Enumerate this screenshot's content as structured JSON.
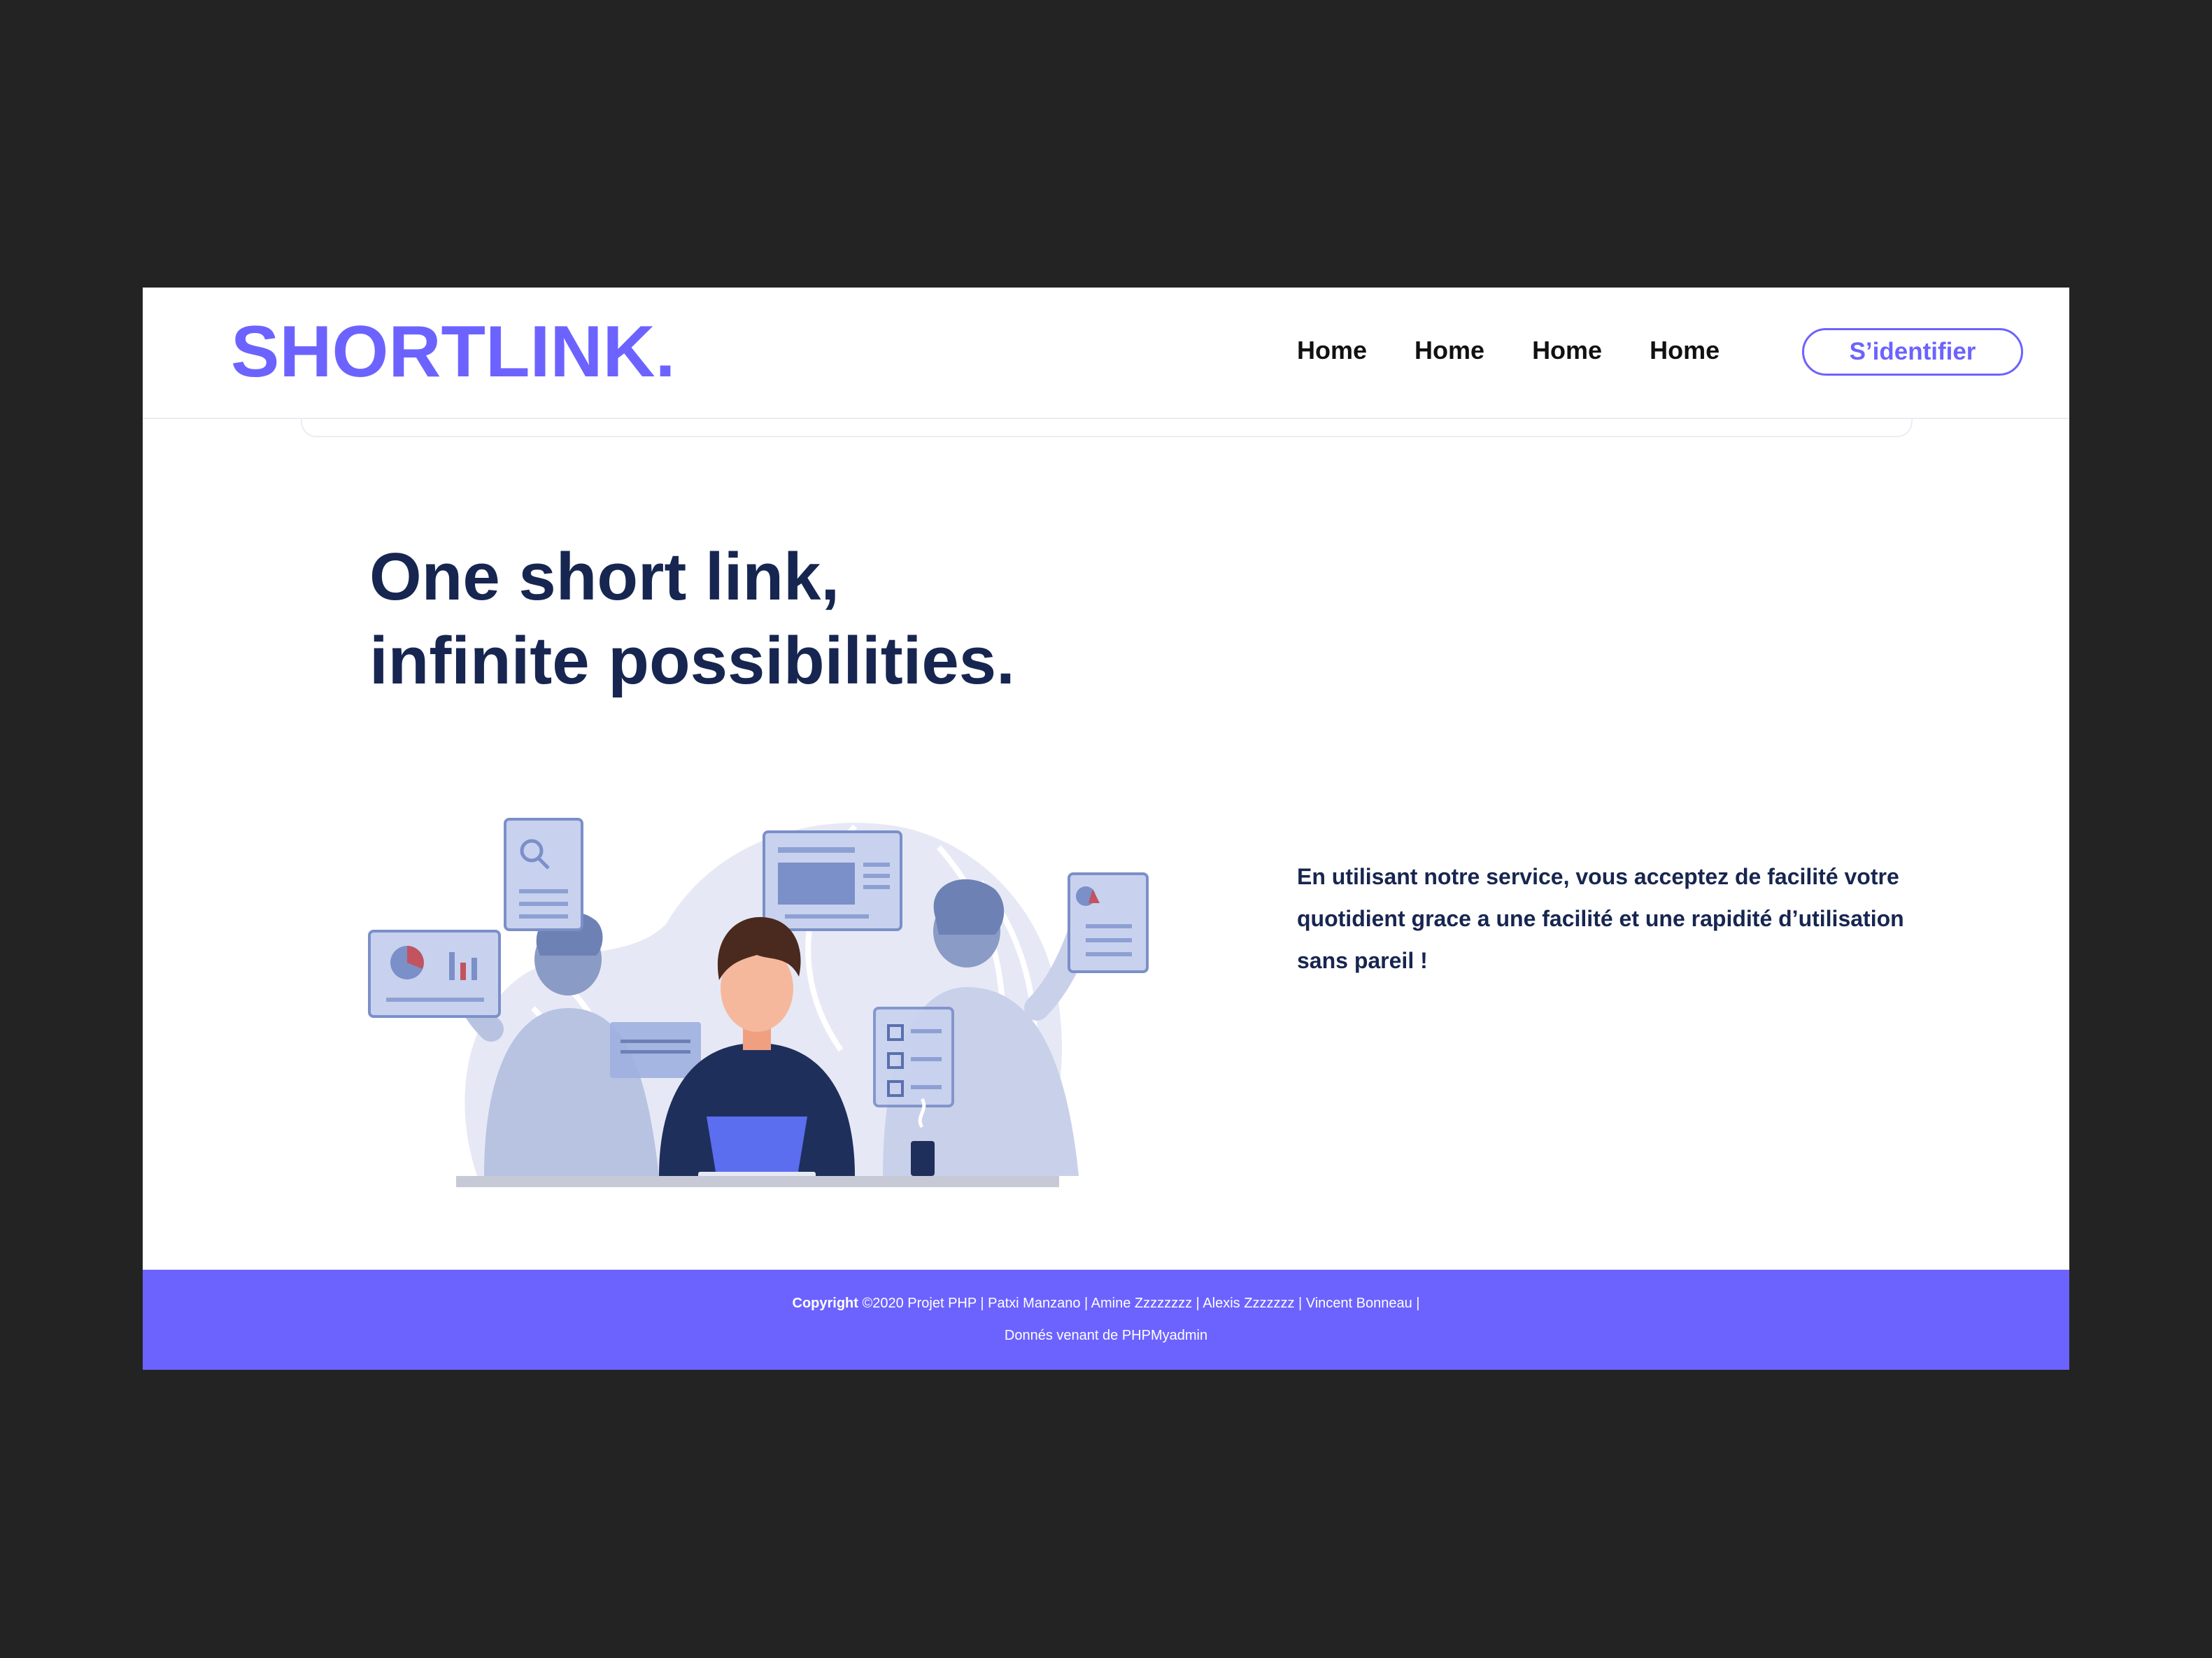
{
  "header": {
    "logo": "SHORTLINK.",
    "nav": [
      "Home",
      "Home",
      "Home",
      "Home"
    ],
    "login_label": "S’identifier"
  },
  "hero": {
    "title_line1": "One short link,",
    "title_line2": "infinite possibilities.",
    "description": "En utilisant notre service, vous acceptez de facilité votre quotidient grace a une facilité et une rapidité d’utilisation sans pareil !"
  },
  "footer": {
    "copyright_label": "Copyright",
    "copyright_text": "©2020 Projet PHP | Patxi Manzano | Amine Zzzzzzzz | Alexis Zzzzzzz | Vincent Bonneau |",
    "source_text": "Donnés venant de PHPMyadmin"
  },
  "colors": {
    "accent": "#6c63ff",
    "heading": "#172650",
    "backdrop": "#232323"
  }
}
